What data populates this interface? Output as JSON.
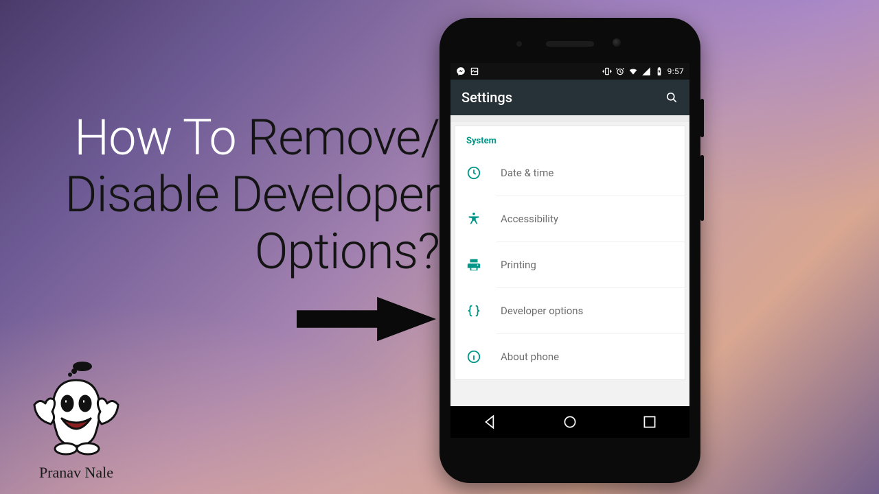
{
  "title": {
    "l1a": "How To ",
    "l1b": "Remove/",
    "l2": "Disable Developer",
    "l3": "Options?"
  },
  "mascot_name": "Pranav Nale",
  "phone": {
    "statusbar": {
      "time": "9:57"
    },
    "appbar": {
      "title": "Settings"
    },
    "section_label": "System",
    "items": [
      {
        "icon": "clock",
        "label": "Date & time"
      },
      {
        "icon": "accessibility",
        "label": "Accessibility"
      },
      {
        "icon": "print",
        "label": "Printing"
      },
      {
        "icon": "braces",
        "label": "Developer options"
      },
      {
        "icon": "info",
        "label": "About phone"
      }
    ]
  }
}
